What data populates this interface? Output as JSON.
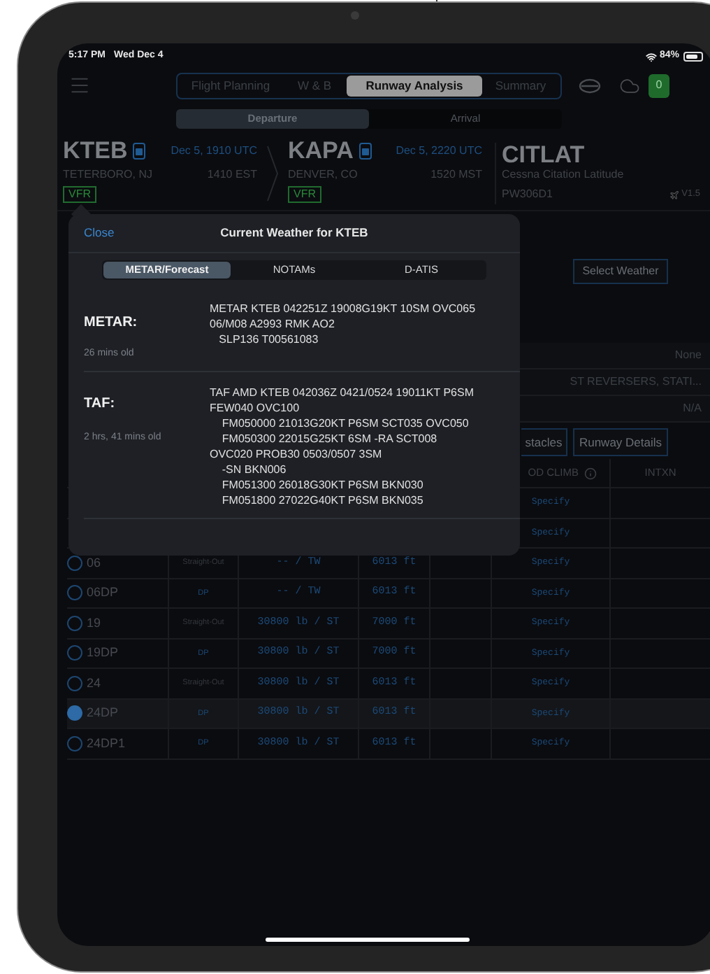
{
  "status_bar": {
    "time": "5:17 PM",
    "date": "Wed Dec 4",
    "battery": "84%"
  },
  "nav": {
    "tabs": [
      {
        "label": "Flight Planning",
        "selected": false
      },
      {
        "label": "W & B",
        "selected": false
      },
      {
        "label": "Runway Analysis",
        "selected": true
      },
      {
        "label": "Summary",
        "selected": false
      }
    ],
    "badge": "0"
  },
  "mode_tabs": [
    {
      "label": "Departure",
      "selected": true
    },
    {
      "label": "Arrival",
      "selected": false
    }
  ],
  "airports": [
    {
      "code": "KTEB",
      "datetime": "Dec 5, 1910 UTC",
      "city": "TETERBORO, NJ",
      "local_time": "1410 EST",
      "category": "VFR"
    },
    {
      "code": "KAPA",
      "datetime": "Dec 5, 2220 UTC",
      "city": "DENVER, CO",
      "local_time": "1520 MST",
      "category": "VFR"
    }
  ],
  "aircraft": {
    "code": "CITLAT",
    "name": "Cessna Citation Latitude",
    "engine": "PW306D1",
    "version": "V1.5"
  },
  "select_weather": "Select Weather",
  "settings_values": [
    "None",
    "ST REVERSERS, STATI...",
    "N/A"
  ],
  "buttons": [
    "stacles",
    "Runway Details"
  ],
  "table": {
    "columns": [
      "OD CLIMB",
      "INTXN"
    ],
    "rows": [
      {
        "climb": "Specify"
      },
      {
        "climb": "Specify"
      },
      {
        "runway": "06",
        "type": "Straight-Out",
        "kind": "straight",
        "weight": "-- / TW",
        "length": "6013 ft",
        "climb": "Specify",
        "selected": false
      },
      {
        "runway": "06DP",
        "type": "DP",
        "kind": "dp",
        "weight": "-- / TW",
        "length": "6013 ft",
        "climb": "Specify",
        "selected": false
      },
      {
        "runway": "19",
        "type": "Straight-Out",
        "kind": "straight",
        "weight": "30800 lb / ST",
        "length": "7000 ft",
        "climb": "Specify",
        "selected": false
      },
      {
        "runway": "19DP",
        "type": "DP",
        "kind": "dp",
        "weight": "30800 lb / ST",
        "length": "7000 ft",
        "climb": "Specify",
        "selected": false
      },
      {
        "runway": "24",
        "type": "Straight-Out",
        "kind": "straight",
        "weight": "30800 lb / ST",
        "length": "6013 ft",
        "climb": "Specify",
        "selected": false
      },
      {
        "runway": "24DP",
        "type": "DP",
        "kind": "dp",
        "weight": "30800 lb / ST",
        "length": "6013 ft",
        "climb": "Specify",
        "selected": true
      },
      {
        "runway": "24DP1",
        "type": "DP",
        "kind": "dp",
        "weight": "30800 lb / ST",
        "length": "6013 ft",
        "climb": "Specify",
        "selected": false
      }
    ]
  },
  "weather_popover": {
    "close": "Close",
    "title": "Current Weather for KTEB",
    "tabs": [
      {
        "label": "METAR/Forecast",
        "selected": true
      },
      {
        "label": "NOTAMs",
        "selected": false
      },
      {
        "label": "D-ATIS",
        "selected": false
      }
    ],
    "sections": [
      {
        "label": "METAR:",
        "age": "26 mins old",
        "text": "METAR KTEB 042251Z 19008G19KT 10SM OVC065\n06/M08 A2993 RMK AO2\n   SLP136 T00561083"
      },
      {
        "label": "TAF:",
        "age": "2 hrs, 41 mins old",
        "text": "TAF AMD KTEB 042036Z 0421/0524 19011KT P6SM\nFEW040 OVC100\n    FM050000 21013G20KT P6SM SCT035 OVC050\n    FM050300 22015G25KT 6SM -RA SCT008\nOVC020 PROB30 0503/0507 3SM\n    -SN BKN006\n    FM051300 26018G30KT P6SM BKN030\n    FM051800 27022G40KT P6SM BKN035"
      }
    ]
  }
}
